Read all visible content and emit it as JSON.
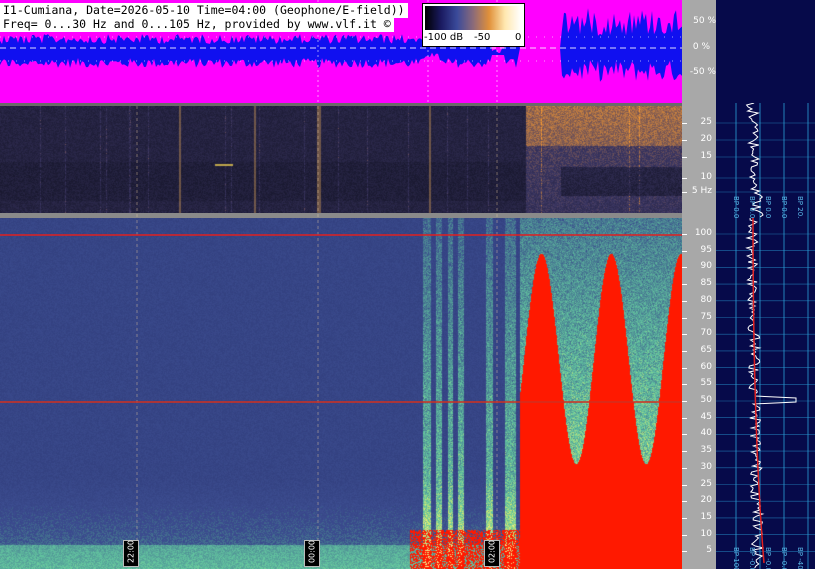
{
  "header": {
    "line1": "I1-Cumiana, Date=2026-05-10 Time=04:00 (Geophone/E-field))",
    "line2": "Freq= 0...30 Hz and 0...105 Hz, provided by www.vlf.it ©"
  },
  "colorbar": {
    "labels": [
      "-100 dB",
      "-50",
      "0"
    ],
    "stops": [
      "#000000",
      "#1a1a60",
      "#3a4a9a",
      "#8a6a7a",
      "#e0903a",
      "#ffe8b0",
      "#ffffff"
    ]
  },
  "amplitude_scale": {
    "ticks": [
      "50 %",
      "0 %",
      "-50 %"
    ]
  },
  "low_freq_scale": {
    "ticks": [
      "25",
      "20",
      "15",
      "10",
      "5 Hz"
    ]
  },
  "main_freq_scale": {
    "ticks": [
      "100",
      "95",
      "90",
      "85",
      "80",
      "75",
      "70",
      "65",
      "60",
      "55",
      "50",
      "45",
      "40",
      "35",
      "30",
      "25",
      "20",
      "15",
      "10",
      "5"
    ]
  },
  "time_markers": [
    "22:00",
    "00:00",
    "02:00"
  ],
  "spectrum_upper": {
    "labels": [
      "BP 0.01",
      "BP 0.00",
      "BP 0.00",
      "BP 0.00",
      "BP 20.0"
    ]
  },
  "spectrum_lower": {
    "labels": [
      "BP 100",
      "BP -0.0",
      "BP -0.0",
      "BP -0.0",
      "BP -40.0"
    ]
  },
  "colors": {
    "amplitude_fill": "#1010f0",
    "amplitude_clip": "#ff00ff",
    "grid": "#2a9fd8",
    "panel_gray": "#a8a8a8",
    "marker_red": "#e02020",
    "saturation": "#ff1a00"
  }
}
